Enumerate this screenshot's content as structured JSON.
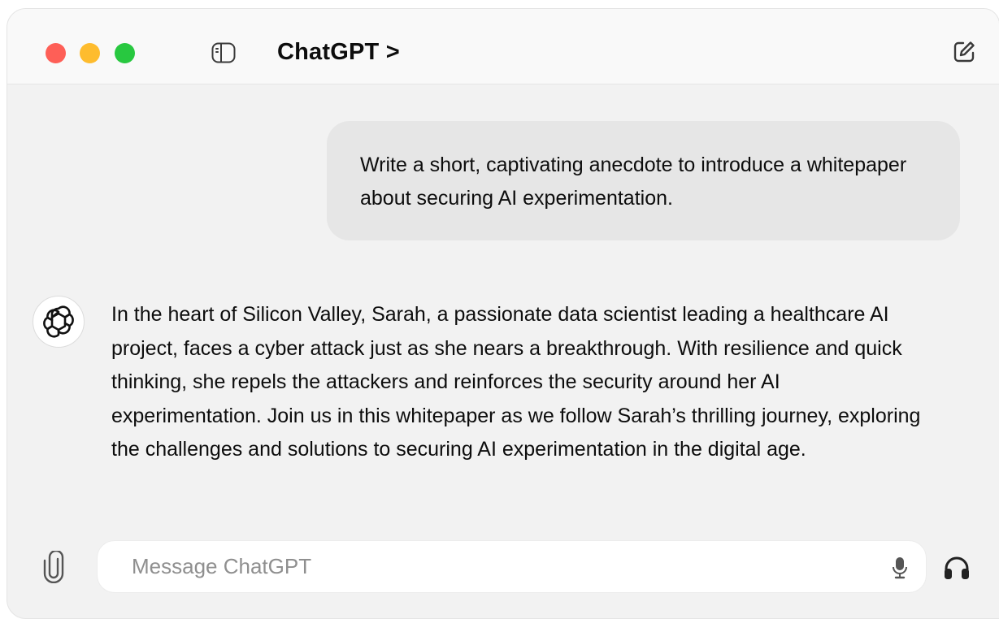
{
  "window": {
    "title": "ChatGPT",
    "title_chevron": ">"
  },
  "conversation": {
    "user_message": "Write a short, captivating anecdote to introduce a whitepaper about securing AI experimentation.",
    "assistant_message": "In the heart of Silicon Valley, Sarah, a passionate data scientist leading a healthcare AI project, faces a cyber attack just as she nears a breakthrough. With resilience and quick thinking, she repels the attackers and reinforces the security around her AI experimentation. Join us in this whitepaper as we follow Sarah’s thrilling journey, exploring the challenges and solutions to securing AI experimentation in the digital age."
  },
  "composer": {
    "placeholder": "Message ChatGPT",
    "value": ""
  },
  "icons": {
    "sidebar_toggle": "sidebar-icon",
    "new_chat": "compose-icon",
    "avatar": "openai-logo-icon",
    "attach": "paperclip-icon",
    "mic": "microphone-icon",
    "voice": "headphones-icon"
  },
  "colors": {
    "close": "#fe5f57",
    "minimize": "#febc2e",
    "maximize": "#28c840",
    "window_bg": "#f2f2f2",
    "user_bubble": "#e6e6e6",
    "text": "#0d0d0d"
  }
}
